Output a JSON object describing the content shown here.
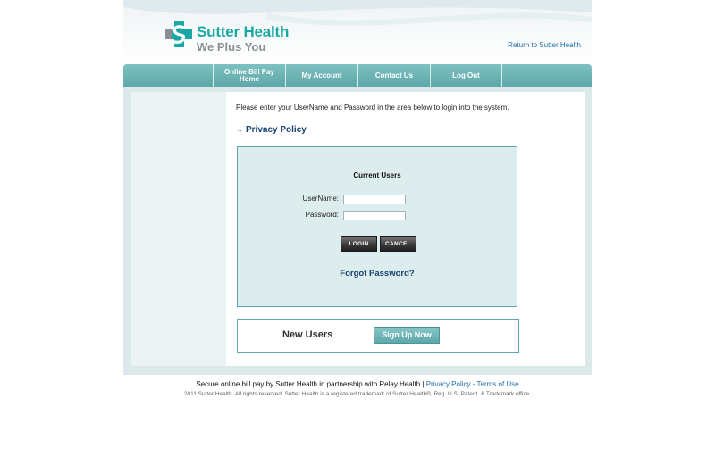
{
  "header": {
    "brand_name": "Sutter Health",
    "tagline": "We Plus You",
    "return_link": "Return to Sutter Health",
    "logo_icon": "sutter-s-cross-icon"
  },
  "nav": {
    "items": [
      {
        "label": "Online Bill Pay Home"
      },
      {
        "label": "My Account"
      },
      {
        "label": "Contact Us"
      },
      {
        "label": "Log Out"
      }
    ]
  },
  "main": {
    "intro": "Please enter your UserName and Password in the area below to login into the system.",
    "privacy_policy": "Privacy Policy",
    "privacy_arrow_icon": "arrow-right-icon",
    "login": {
      "title": "Current Users",
      "username_label": "UserName:",
      "username_value": "",
      "password_label": "Password:",
      "password_value": "",
      "login_button": "LOGIN",
      "cancel_button": "CANCEL",
      "forgot_password": "Forgot Password?"
    },
    "new_users": {
      "label": "New Users",
      "signup_button": "Sign Up Now"
    }
  },
  "footer": {
    "line1_text": "Secure online bill pay by Sutter Health in partnership with Relay Health |",
    "privacy_link": "Privacy Policy",
    "separator": "-",
    "terms_link": "Terms of Use",
    "copyright": "2011 Sutter Health. All rights reserved. Sutter Health is a registered trademark of Sutter Health®, Reg. U.S. Patent. & Trademark office."
  },
  "colors": {
    "brand_teal": "#1aa8a2",
    "nav_teal": "#6fb5b7",
    "link_blue": "#1f6fa8",
    "dark_navy": "#17406e"
  }
}
